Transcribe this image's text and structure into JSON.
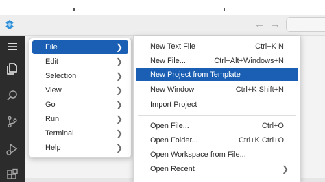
{
  "main_menu": {
    "items": [
      {
        "label": "File",
        "submenu_icon": "chevron-right-icon"
      },
      {
        "label": "Edit",
        "submenu_icon": "chevron-right-icon"
      },
      {
        "label": "Selection",
        "submenu_icon": "chevron-right-icon"
      },
      {
        "label": "View",
        "submenu_icon": "chevron-right-icon"
      },
      {
        "label": "Go",
        "submenu_icon": "chevron-right-icon"
      },
      {
        "label": "Run",
        "submenu_icon": "chevron-right-icon"
      },
      {
        "label": "Terminal",
        "submenu_icon": "chevron-right-icon"
      },
      {
        "label": "Help",
        "submenu_icon": "chevron-right-icon"
      }
    ],
    "selected": "File"
  },
  "file_menu": {
    "items": [
      {
        "label": "New Text File",
        "shortcut": "Ctrl+K N"
      },
      {
        "label": "New File...",
        "shortcut": "Ctrl+Alt+Windows+N"
      },
      {
        "label": "New Project from Template",
        "shortcut": ""
      },
      {
        "label": "New Window",
        "shortcut": "Ctrl+K Shift+N"
      },
      {
        "label": "Import Project",
        "shortcut": ""
      },
      {
        "label": "Open File...",
        "shortcut": "Ctrl+O"
      },
      {
        "label": "Open Folder...",
        "shortcut": "Ctrl+K Ctrl+O"
      },
      {
        "label": "Open Workspace from File...",
        "shortcut": ""
      },
      {
        "label": "Open Recent",
        "shortcut": ""
      }
    ],
    "selected": "New Project from Template"
  },
  "titlebar": {
    "back_icon": "arrow-left-icon",
    "forward_icon": "arrow-right-icon"
  },
  "activity_bar": {
    "icons": [
      "menu-icon",
      "explorer-icon",
      "search-icon",
      "source-control-icon",
      "run-debug-icon",
      "extensions-icon"
    ]
  },
  "colors": {
    "selection": "#1a5fb4",
    "activity_bar": "#2c2c2c",
    "titlebar": "#eeeeee",
    "logo": "#2f8fd8"
  }
}
